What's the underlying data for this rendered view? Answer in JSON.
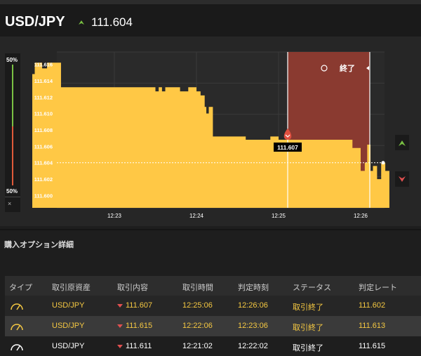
{
  "header": {
    "pair": "USD/JPY",
    "rate": "111.604",
    "rate_direction": "up"
  },
  "chart": {
    "left_pct_top": "50%",
    "left_pct_bottom": "50%",
    "close_label": "終了",
    "current_marker": "111.607",
    "y_ticks": [
      "111.616",
      "111.614",
      "111.612",
      "111.610",
      "111.608",
      "111.606",
      "111.604",
      "111.602",
      "111.600"
    ],
    "x_ticks": [
      "12:23",
      "12:24",
      "12:25",
      "12:26"
    ],
    "up_button_color": "#7ac143",
    "down_button_color": "#e05050",
    "fill_color": "#ffc845",
    "expiry_zone_color": "#8a3a30"
  },
  "chart_data": {
    "type": "area",
    "title": "",
    "xlabel": "",
    "ylabel": "",
    "ylim": [
      111.5985,
      111.6175
    ],
    "x_ticks": [
      "12:23",
      "12:24",
      "12:25",
      "12:26"
    ],
    "series": [
      {
        "values_x_minutes": [
          22.0,
          22.03,
          22.07,
          22.12,
          22.18,
          22.35,
          22.6,
          22.9,
          23.2,
          23.5,
          23.54,
          23.58,
          23.62,
          23.8,
          23.9,
          24.0,
          24.05,
          24.1,
          24.12,
          24.15,
          24.2,
          24.5,
          24.6,
          24.9,
          25.0,
          25.2,
          25.4,
          25.6,
          25.8,
          25.9,
          26.0,
          26.05,
          26.08,
          26.12,
          26.15,
          26.2,
          26.25,
          26.3,
          26.35
        ],
        "values": [
          111.6148,
          111.6162,
          111.6162,
          111.6155,
          111.6162,
          111.6132,
          111.6132,
          111.6132,
          111.6132,
          111.6127,
          111.6132,
          111.6127,
          111.6132,
          111.6127,
          111.6132,
          111.6127,
          111.6122,
          111.6108,
          111.61,
          111.6108,
          111.6072,
          111.6072,
          111.6068,
          111.6072,
          111.6068,
          111.6068,
          111.6068,
          111.6068,
          111.6068,
          111.6058,
          111.603,
          111.604,
          111.6062,
          111.603,
          111.6036,
          111.602,
          111.604,
          111.603,
          111.6036
        ]
      }
    ],
    "markers": [
      {
        "label": "111.607",
        "x_minutes": 25.1,
        "y": 111.6068
      }
    ],
    "reference_line": 111.604
  },
  "details": {
    "title": "購入オプション詳細",
    "columns": [
      "タイプ",
      "取引原資産",
      "取引内容",
      "取引時間",
      "判定時刻",
      "ステータス",
      "判定レート"
    ],
    "rows": [
      {
        "asset": "USD/JPY",
        "content": "111.607",
        "time": "12:25:06",
        "judge": "12:26:06",
        "status": "取引終了",
        "rate": "111.602",
        "color": "#f5c842"
      },
      {
        "asset": "USD/JPY",
        "content": "111.615",
        "time": "12:22:06",
        "judge": "12:23:06",
        "status": "取引終了",
        "rate": "111.613",
        "color": "#f5c842"
      },
      {
        "asset": "USD/JPY",
        "content": "111.611",
        "time": "12:21:02",
        "judge": "12:22:02",
        "status": "取引終了",
        "rate": "111.615",
        "color": "#ffffff"
      }
    ]
  }
}
